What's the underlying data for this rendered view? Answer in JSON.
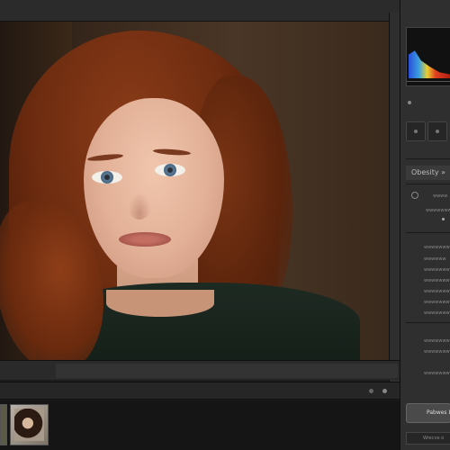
{
  "panel": {
    "section_title": "Obesity »",
    "labels": [
      "wwww",
      "wwwwwwww",
      "wwwwwwww",
      "wwwwww",
      "wwwwwww",
      "wwwwwww",
      "wwwwwwww",
      "wwwwwww",
      "wwwwwwww",
      "wwwwwww",
      "wwwwwww",
      "wwwwwww"
    ],
    "apply_button": "Pabwes L",
    "bottom_label": "Wrecve o"
  },
  "colors": {
    "panel_bg": "#2f2f2f",
    "viewer_bg": "#3a2a1e",
    "filmstrip_bg": "#151515"
  },
  "icons": [
    "histogram-icon",
    "dot-icon",
    "radio-icon"
  ]
}
